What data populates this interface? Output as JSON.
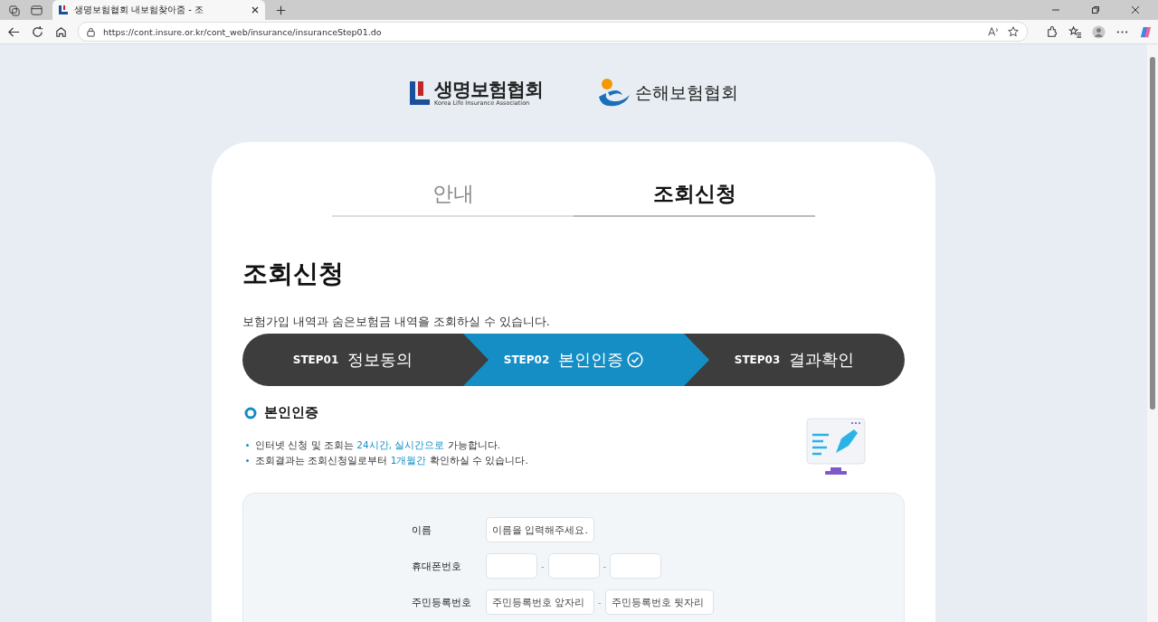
{
  "browser": {
    "tab_title": "생명보험협회 내보험찾아줌 - 조",
    "url": "https://cont.insure.or.kr/cont_web/insurance/insuranceStep01.do"
  },
  "logos": {
    "life": {
      "name": "생명보험협회",
      "subtitle": "Korea Life Insurance Association"
    },
    "nonlife": {
      "name": "손해보험협회"
    }
  },
  "tabs": [
    {
      "label": "안내",
      "selected": false
    },
    {
      "label": "조회신청",
      "selected": true
    }
  ],
  "heading": "조회신청",
  "description": "보험가입 내역과 숨은보험금 내역을 조회하실 수 있습니다.",
  "steps": [
    {
      "number": "STEP01",
      "label": "정보동의",
      "selected": false
    },
    {
      "number": "STEP02",
      "label": "본인인증",
      "selected": true
    },
    {
      "number": "STEP03",
      "label": "결과확인",
      "selected": false
    }
  ],
  "section_title": "본인인증",
  "notes": [
    "인터넷 신청 및 조회는 **24시간, 실시간으로** 가능합니다.",
    "조회결과는 조회신청일로부터 **1개월간** 확인하실 수 있습니다."
  ],
  "form": [
    {
      "label": "이름",
      "parts": [
        {
          "kind": "field",
          "placeholder": "이름을 입력해주세요."
        }
      ]
    },
    {
      "label": "휴대폰번호",
      "parts": [
        {
          "kind": "field"
        },
        {
          "kind": "dash",
          "text": "-"
        },
        {
          "kind": "field"
        },
        {
          "kind": "dash",
          "text": "-"
        },
        {
          "kind": "field"
        }
      ]
    },
    {
      "label": "주민등록번호",
      "parts": [
        {
          "kind": "field",
          "placeholder": "주민등록번호 앞자리"
        },
        {
          "kind": "dash",
          "text": "-"
        },
        {
          "kind": "field",
          "placeholder": "주민등록번호 뒷자리"
        }
      ]
    }
  ]
}
